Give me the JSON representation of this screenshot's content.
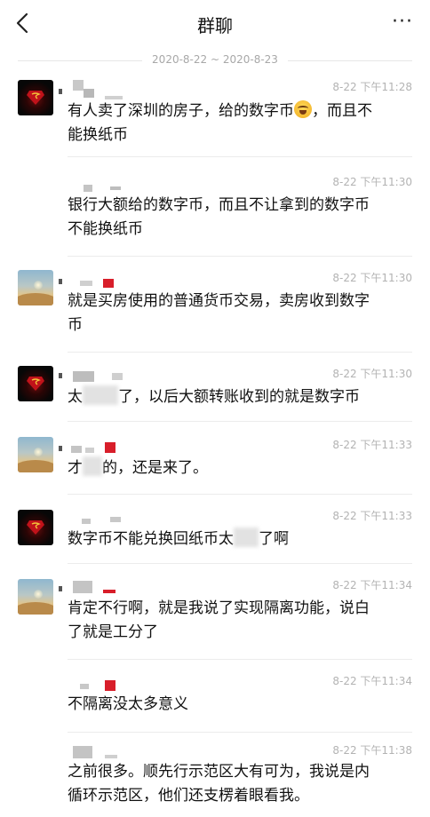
{
  "header": {
    "title": "群聊",
    "more": "···"
  },
  "date_range": "2020-8-22 ~ 2020-8-23",
  "messages": [
    {
      "time": "8-22 下午11:28",
      "text_parts": [
        "有人卖了深圳的房子，给的数字币",
        "，而且不",
        "能换纸币"
      ],
      "avatar": "superman"
    },
    {
      "time": "8-22 下午11:30",
      "text_parts": [
        "银行大额给的数字币，而且不让拿到的数字币",
        "不能换纸币"
      ],
      "avatar": "none"
    },
    {
      "time": "8-22 下午11:30",
      "text_parts": [
        "就是买房使用的普通货币交易，卖房收到数字",
        "币"
      ],
      "avatar": "sky"
    },
    {
      "time": "8-22 下午11:30",
      "text_parts": [
        "太",
        "了，以后大额转账收到的就是数字币"
      ],
      "avatar": "superman"
    },
    {
      "time": "8-22 下午11:33",
      "text_parts": [
        "才",
        "的，还是来了。"
      ],
      "avatar": "sky"
    },
    {
      "time": "8-22 下午11:33",
      "text_parts": [
        "数字币不能兑换回纸币太",
        "了啊"
      ],
      "avatar": "superman"
    },
    {
      "time": "8-22 下午11:34",
      "text_parts": [
        "肯定不行啊，就是我说了实现隔离功能，说白",
        "了就是工分了"
      ],
      "avatar": "sky"
    },
    {
      "time": "8-22 下午11:34",
      "text_parts": [
        "不隔离没太多意义"
      ],
      "avatar": "none"
    },
    {
      "time": "8-22 下午11:38",
      "text_parts": [
        "之前很多。顺先行示范区大有可为，我说是内",
        "循环示范区，他们还支楞着眼看我。"
      ],
      "avatar": "none"
    }
  ],
  "colors": {
    "superman_red": "#c0121a",
    "nick_red": "#d81e2a",
    "time_gray": "#b3b3b3"
  },
  "icons": {
    "back": "chevron-left-icon",
    "more": "ellipsis-icon",
    "emoji": "tears-of-joy-emoji"
  }
}
